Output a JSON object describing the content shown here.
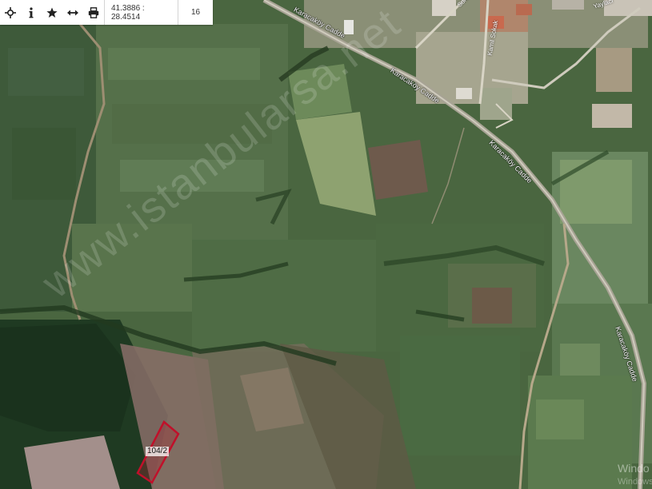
{
  "toolbar": {
    "tools": [
      {
        "icon": "locate-crosshair-icon"
      },
      {
        "icon": "info-icon"
      },
      {
        "icon": "star-icon"
      },
      {
        "icon": "measure-arrows-icon"
      },
      {
        "icon": "printer-icon"
      }
    ],
    "coordinates": "41.3886 : 28.4514",
    "zoom": "16"
  },
  "map": {
    "roads": [
      {
        "label": "Karacaköy Cadde"
      },
      {
        "label": "Karacaköy Cadde"
      },
      {
        "label": "Karacaköy Cadde"
      }
    ],
    "streets": [
      {
        "label": "Yaylacı"
      },
      {
        "label": "Kamil Sokak"
      },
      {
        "label": "Sokak"
      }
    ],
    "watermark": "www.istanbularsa.net",
    "parcel": {
      "label": "104/2",
      "outline_color": "#c0102a"
    },
    "os_overlay": {
      "line1": "Windo",
      "line2": "Windows"
    }
  }
}
